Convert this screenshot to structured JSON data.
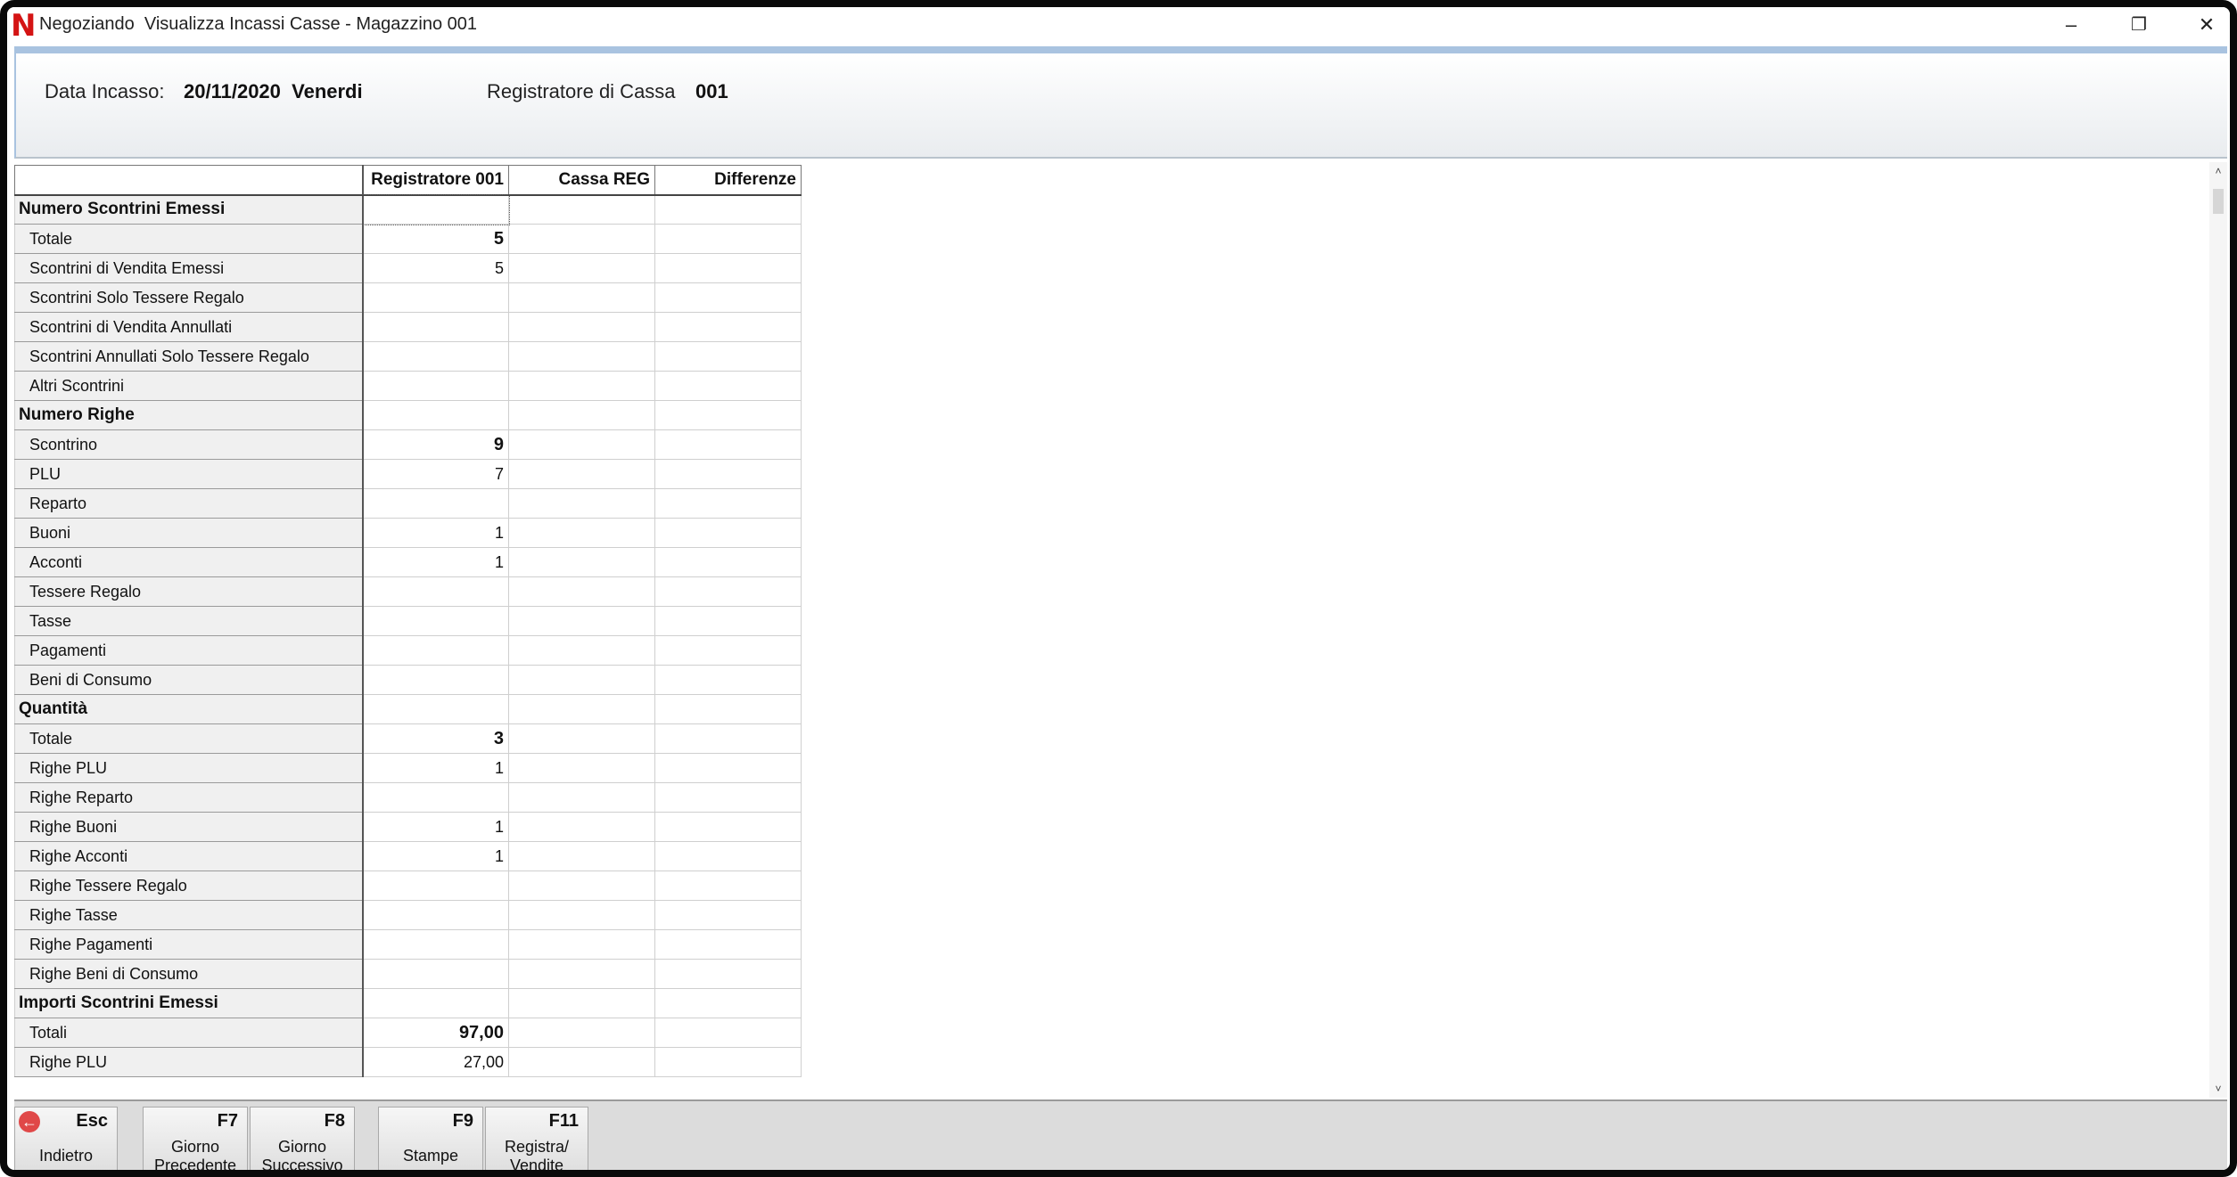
{
  "window": {
    "title": "Negoziando  Visualizza Incassi Casse - Magazzino 001",
    "logo": "N",
    "minimize": "–",
    "maximize": "❐",
    "close": "✕"
  },
  "info": {
    "date_label": "Data Incasso:",
    "date_value": "20/11/2020  Venerdi",
    "register_label": "Registratore di Cassa",
    "register_value": "001"
  },
  "grid": {
    "columns": [
      "Registratore 001",
      "Cassa REG",
      "Differenze"
    ],
    "rows": [
      {
        "label": "Numero Scontrini Emessi",
        "group": true,
        "values": [
          "",
          "",
          ""
        ]
      },
      {
        "label": "Totale",
        "group": false,
        "bold": true,
        "values": [
          "5",
          "",
          ""
        ]
      },
      {
        "label": "Scontrini di Vendita Emessi",
        "group": false,
        "values": [
          "5",
          "",
          ""
        ]
      },
      {
        "label": "Scontrini Solo Tessere Regalo",
        "group": false,
        "values": [
          "",
          "",
          ""
        ]
      },
      {
        "label": "Scontrini di Vendita Annullati",
        "group": false,
        "values": [
          "",
          "",
          ""
        ]
      },
      {
        "label": "Scontrini Annullati Solo Tessere Regalo",
        "group": false,
        "values": [
          "",
          "",
          ""
        ]
      },
      {
        "label": "Altri Scontrini",
        "group": false,
        "values": [
          "",
          "",
          ""
        ]
      },
      {
        "label": "Numero Righe",
        "group": true,
        "values": [
          "",
          "",
          ""
        ]
      },
      {
        "label": "Scontrino",
        "group": false,
        "bold": true,
        "values": [
          "9",
          "",
          ""
        ]
      },
      {
        "label": "PLU",
        "group": false,
        "values": [
          "7",
          "",
          ""
        ]
      },
      {
        "label": "Reparto",
        "group": false,
        "values": [
          "",
          "",
          ""
        ]
      },
      {
        "label": "Buoni",
        "group": false,
        "values": [
          "1",
          "",
          ""
        ]
      },
      {
        "label": "Acconti",
        "group": false,
        "values": [
          "1",
          "",
          ""
        ]
      },
      {
        "label": "Tessere Regalo",
        "group": false,
        "values": [
          "",
          "",
          ""
        ]
      },
      {
        "label": "Tasse",
        "group": false,
        "values": [
          "",
          "",
          ""
        ]
      },
      {
        "label": "Pagamenti",
        "group": false,
        "values": [
          "",
          "",
          ""
        ]
      },
      {
        "label": "Beni di Consumo",
        "group": false,
        "values": [
          "",
          "",
          ""
        ]
      },
      {
        "label": "Quantità",
        "group": true,
        "values": [
          "",
          "",
          ""
        ]
      },
      {
        "label": "Totale",
        "group": false,
        "bold": true,
        "values": [
          "3",
          "",
          ""
        ]
      },
      {
        "label": "Righe PLU",
        "group": false,
        "values": [
          "1",
          "",
          ""
        ]
      },
      {
        "label": "Righe Reparto",
        "group": false,
        "values": [
          "",
          "",
          ""
        ]
      },
      {
        "label": "Righe Buoni",
        "group": false,
        "values": [
          "1",
          "",
          ""
        ]
      },
      {
        "label": "Righe Acconti",
        "group": false,
        "values": [
          "1",
          "",
          ""
        ]
      },
      {
        "label": "Righe Tessere Regalo",
        "group": false,
        "values": [
          "",
          "",
          ""
        ]
      },
      {
        "label": "Righe Tasse",
        "group": false,
        "values": [
          "",
          "",
          ""
        ]
      },
      {
        "label": "Righe Pagamenti",
        "group": false,
        "values": [
          "",
          "",
          ""
        ]
      },
      {
        "label": "Righe Beni di Consumo",
        "group": false,
        "values": [
          "",
          "",
          ""
        ]
      },
      {
        "label": "Importi Scontrini Emessi",
        "group": true,
        "values": [
          "",
          "",
          ""
        ]
      },
      {
        "label": "Totali",
        "group": false,
        "bold": true,
        "values": [
          "97,00",
          "",
          ""
        ]
      },
      {
        "label": "Righe PLU",
        "group": false,
        "values": [
          "27,00",
          "",
          ""
        ]
      }
    ]
  },
  "scrollbar": {
    "up": "˄",
    "down": "˅"
  },
  "toolbar": {
    "buttons": [
      {
        "key": "Esc",
        "label": "Indietro",
        "name": "back-button"
      },
      {
        "key": "F7",
        "label": "Giorno\nPrecedente",
        "name": "previous-day-button"
      },
      {
        "key": "F8",
        "label": "Giorno\nSuccessivo",
        "name": "next-day-button"
      },
      {
        "key": "F9",
        "label": "Stampe",
        "name": "print-button"
      },
      {
        "key": "F11",
        "label": "Registra/\nVendite",
        "name": "register-sales-button"
      }
    ]
  },
  "colors": {
    "accent": "#a9c3e0",
    "logo": "#d41414",
    "back_icon": "#e04848"
  }
}
